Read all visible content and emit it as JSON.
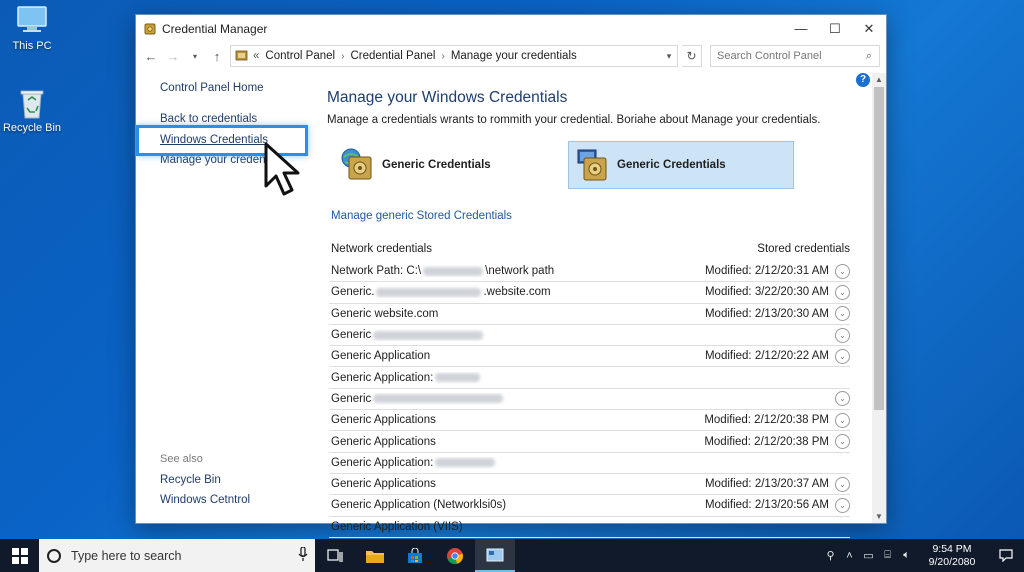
{
  "desktop": {
    "icons": [
      {
        "label": "This PC"
      },
      {
        "label": "Recycle Bin"
      }
    ]
  },
  "window": {
    "title": "Credential Manager",
    "controls": {
      "minimize": "—",
      "maximize": "☐",
      "close": "✕"
    },
    "address": {
      "prefix": "«",
      "crumbs": [
        "Control Panel",
        "Credential Panel",
        "Manage your credentials"
      ],
      "search_placeholder": "Search Control Panel"
    },
    "left_pane": {
      "home": "Control Panel Home",
      "links": [
        "Back to credentials",
        "Windows Credentials",
        "Manage your credentials"
      ],
      "see_also": "See also",
      "see_also_links": [
        "Recycle Bin",
        "Windows Cetntrol"
      ]
    },
    "main": {
      "heading": "Manage your Windows Credentials",
      "description": "Manage a credentials wrants to rommith your credential. Boriahe about Manage your credentials.",
      "tiles": [
        {
          "label": "Generic Credentials",
          "selected": false
        },
        {
          "label": "Generic Credentials",
          "selected": true
        }
      ],
      "manage_link": "Manage generic Stored Credentials",
      "list_header_left": "Network credentials",
      "list_header_right": "Stored credentials",
      "rows": [
        {
          "pre": "Network Path: C:\\",
          "post": "\\network path",
          "modified": "Modified: 2/12/20:31 AM",
          "chevron": true
        },
        {
          "pre": "Generic.",
          "post": ".website.com",
          "modified": "Modified: 3/22/20:30 AM",
          "chevron": true
        },
        {
          "pre": "Generic website.com",
          "post": "",
          "modified": "Modified: 2/13/20:30 AM",
          "chevron": true
        },
        {
          "pre": "Generic",
          "post": "",
          "modified": "",
          "chevron": true,
          "blur_only": true
        },
        {
          "pre": "Generic Application",
          "post": "",
          "modified": "Modified: 2/12/20:22 AM",
          "chevron": true
        },
        {
          "pre": "Generic Application:",
          "post": "",
          "modified": "",
          "chevron": false,
          "blur_only": true
        },
        {
          "pre": "Generic",
          "post": "",
          "modified": "",
          "chevron": true,
          "blur_only": true
        },
        {
          "pre": "Generic Applications",
          "post": "",
          "modified": "Modified: 2/12/20:38 PM",
          "chevron": true
        },
        {
          "pre": "Generic Applications",
          "post": "",
          "modified": "Modified: 2/12/20:38 PM",
          "chevron": true
        },
        {
          "pre": "Generic Application:",
          "post": "",
          "modified": "",
          "chevron": false,
          "blur_only": true
        },
        {
          "pre": "Generic Applications",
          "post": "",
          "modified": "Modified: 2/13/20:37 AM",
          "chevron": true
        },
        {
          "pre": "Generic Application (Networklsi0s)",
          "post": "",
          "modified": "Modified: 2/13/20:56 AM",
          "chevron": true
        },
        {
          "pre": "Generic Application (VIIS)",
          "post": "",
          "modified": "",
          "chevron": false
        }
      ]
    }
  },
  "taskbar": {
    "search_placeholder": "Type here to search",
    "time": "9:54 PM",
    "date": "9/20/2080"
  }
}
